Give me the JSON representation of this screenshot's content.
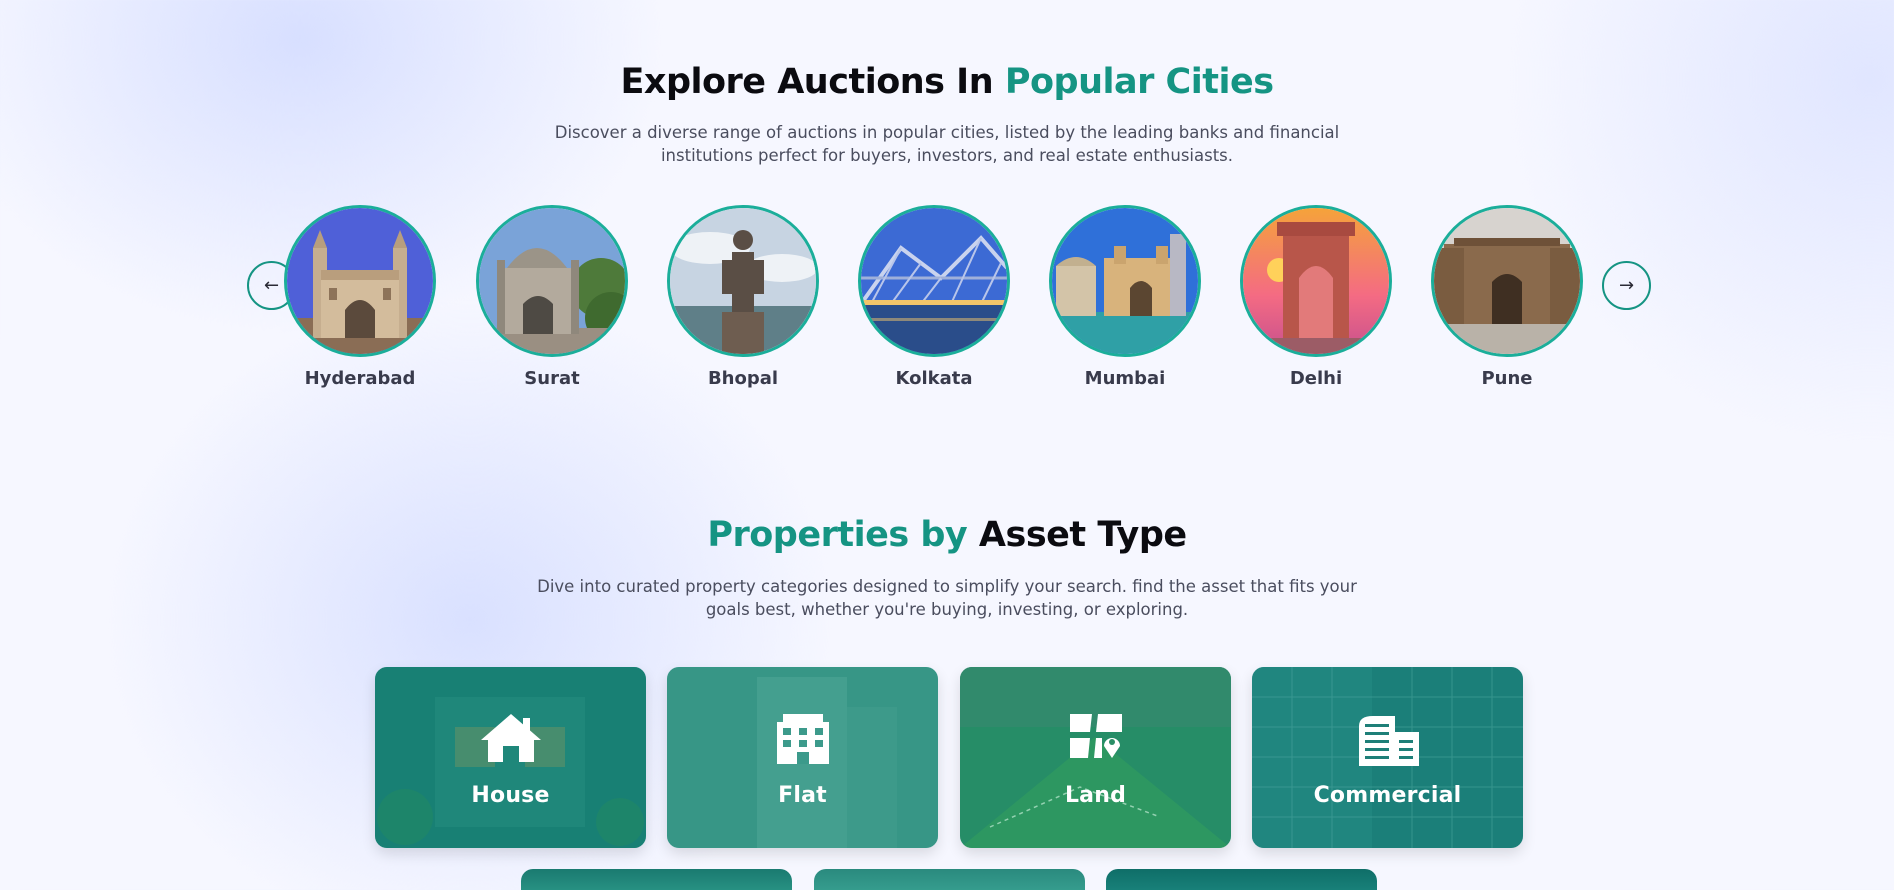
{
  "cities_section": {
    "title_part1": "Explore Auctions In ",
    "title_part2": "Popular Cities",
    "description": "Discover a diverse range of auctions in popular cities, listed by the leading banks and financial institutions perfect for buyers, investors, and real estate enthusiasts.",
    "prev_icon": "arrow-left-icon",
    "next_icon": "arrow-right-icon",
    "prev_glyph": "←",
    "next_glyph": "→",
    "cities": [
      {
        "name": "Hyderabad",
        "image": "charminar"
      },
      {
        "name": "Surat",
        "image": "domed-monument"
      },
      {
        "name": "Bhopal",
        "image": "statue"
      },
      {
        "name": "Kolkata",
        "image": "howrah-bridge"
      },
      {
        "name": "Mumbai",
        "image": "gateway-of-india"
      },
      {
        "name": "Delhi",
        "image": "india-gate"
      },
      {
        "name": "Pune",
        "image": "shaniwar-wada"
      }
    ]
  },
  "asset_section": {
    "title_part1": "Properties by ",
    "title_part2": "Asset Type",
    "description": "Dive into curated property categories designed to simplify your search. find the asset that fits your goals best, whether you're buying, investing, or exploring.",
    "assets": [
      {
        "label": "House",
        "icon": "house-icon"
      },
      {
        "label": "Flat",
        "icon": "building-icon"
      },
      {
        "label": "Land",
        "icon": "land-plot-icon"
      },
      {
        "label": "Commercial",
        "icon": "office-building-icon"
      }
    ]
  },
  "colors": {
    "accent": "#159483",
    "heading_dark": "#0b0b10",
    "body_text": "#4a4d5e",
    "card_teal": "#1b7f74"
  }
}
